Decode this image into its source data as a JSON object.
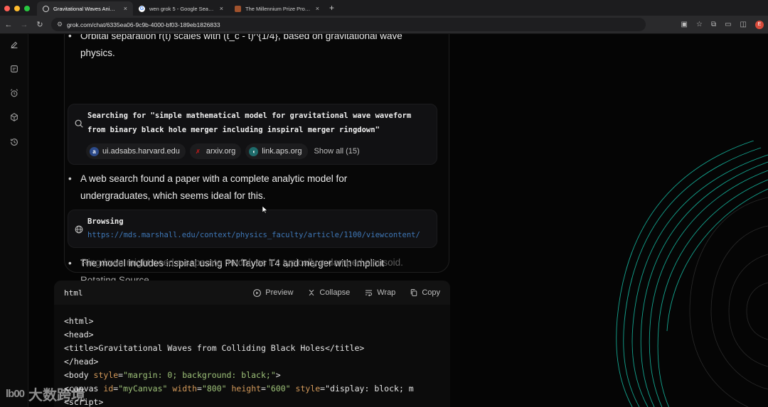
{
  "browser": {
    "tabs": [
      {
        "title": "Gravitational Waves Animatio",
        "active": true,
        "icon": "grok-icon"
      },
      {
        "title": "wen grok 5 - Google Search",
        "active": false,
        "icon": "google-icon"
      },
      {
        "title": "The Millennium Prize Problem",
        "active": false,
        "icon": "clay-institute-icon"
      }
    ],
    "new_tab_label": "+",
    "url": "grok.com/chat/6335ea06-9c9b-4000-bf03-189eb1826833",
    "profile_initial": "E"
  },
  "rail": {
    "icons": [
      "edit-icon",
      "chat-icon",
      "alarm-icon",
      "cube-icon",
      "history-icon"
    ]
  },
  "answer": {
    "bullet_top_line": "Orbital separation r(t) scales with (t_c - t)^{1/4}, based on gravitational wave",
    "bullet_top_line2": "physics.",
    "search_title_1": "Searching for \"simple mathematical model for gravitational wave waveform",
    "search_title_2": "from binary black hole merger including inspiral merger ringdown\"",
    "sources": [
      {
        "label": "ui.adsabs.harvard.edu",
        "icon": "adsabs-icon"
      },
      {
        "label": "arxiv.org",
        "icon": "arxiv-icon"
      },
      {
        "label": "link.aps.org",
        "icon": "aps-icon"
      }
    ],
    "show_all": "Show all (15)",
    "bullet_web_1": "A web search found a paper with a complete analytic model for",
    "bullet_web_2": "undergraduates, which seems ideal for this.",
    "browsing_title": "Browsing",
    "browsing_url": "https://mds.marshall.edu/context/physics_faculty/article/1100/viewcontent/",
    "bullet_model_1": "The model includes inspiral using PN Taylor T4 and merger with Implicit",
    "bullet_model_2": "Rotating Source.",
    "bullet_faded": "Ringdown might need a separate model, as it's typically a damped sinusoid."
  },
  "code": {
    "language": "html",
    "preview_label": "Preview",
    "collapse_label": "Collapse",
    "wrap_label": "Wrap",
    "copy_label": "Copy",
    "lines": [
      "<html>",
      "<head>",
      "<title>Gravitational Waves from Colliding Black Holes</title>",
      "</head>",
      "<body style=\"margin: 0; background: black;\">",
      "<canvas id=\"myCanvas\" width=\"800\" height=\"600\" style=\"display: block; m",
      "<script>"
    ]
  },
  "watermark": {
    "logo_text": "lb00",
    "text": "大数跨境"
  }
}
